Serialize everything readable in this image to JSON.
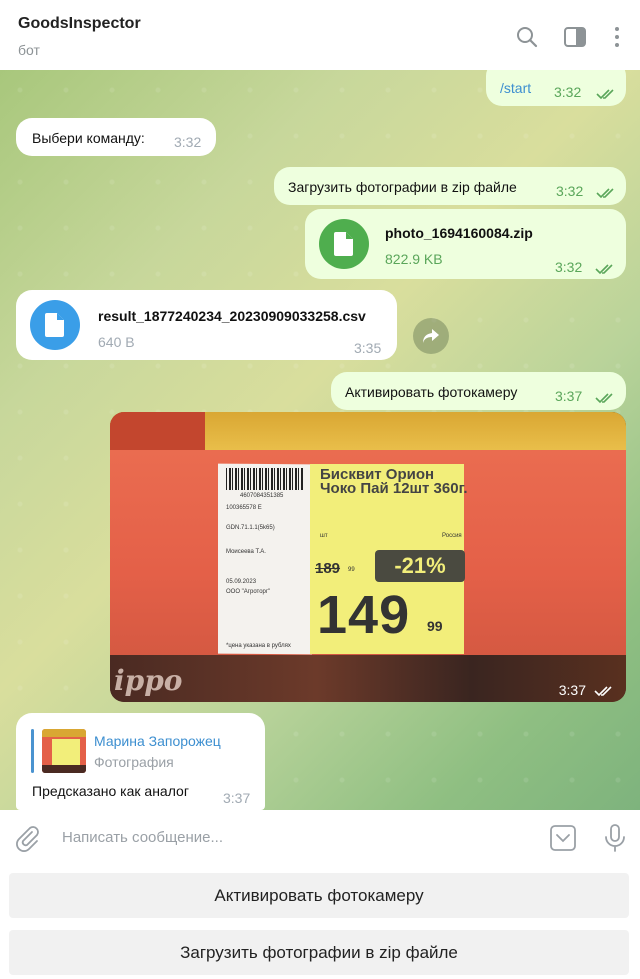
{
  "header": {
    "title": "GoodsInspector",
    "subtitle": "бот",
    "icons": [
      "search-icon",
      "sidebar-toggle-icon",
      "more-vertical-icon"
    ]
  },
  "messages": {
    "m1": {
      "text": "/start",
      "time": "3:32",
      "direction": "outgoing",
      "status": "read"
    },
    "m2": {
      "text": "Выбери команду:",
      "time": "3:32",
      "direction": "incoming"
    },
    "m3": {
      "text": "Загрузить фотографии в zip файле",
      "time": "3:32",
      "direction": "outgoing",
      "status": "read"
    },
    "m4": {
      "file_name": "photo_1694160084.zip",
      "file_size": "822.9 KB",
      "time": "3:32",
      "direction": "outgoing",
      "status": "read",
      "icon": "file-icon"
    },
    "m5": {
      "file_name": "result_1877240234_20230909033258.csv",
      "file_size": "640 B",
      "time": "3:35",
      "direction": "incoming",
      "icon": "file-icon",
      "action_icon": "share-icon"
    },
    "m6": {
      "text": "Активировать фотокамеру",
      "time": "3:37",
      "direction": "outgoing",
      "status": "read"
    },
    "m7": {
      "type": "photo",
      "time": "3:37",
      "direction": "outgoing",
      "status": "read",
      "tag": {
        "barcode_number": "4607084351385",
        "code": "100365578 E",
        "line1": "GDN.71.1.1(5k65)",
        "line2": "Моисеева Т.А.",
        "date": "05.09.2023",
        "company": "ООО \"Агроторг\"",
        "product": "Бисквит Орион Чоко Пай 12шт 360г.",
        "country": "Россия",
        "per": "шт",
        "old_price": "189",
        "old_price_suffix": "99",
        "discount": "-21%",
        "price": "149",
        "price_cents": "99",
        "footer": "*цена указана в рублях"
      },
      "bottom_text": "ippo"
    },
    "m8": {
      "reply_name": "Марина Запорожец",
      "reply_type": "Фотография",
      "text": "Предсказано как аналог",
      "time": "3:37",
      "direction": "incoming"
    }
  },
  "input": {
    "placeholder": "Написать сообщение...",
    "icons": [
      "attach-icon",
      "keyboard-toggle-icon",
      "microphone-icon"
    ]
  },
  "keyboard": {
    "buttons": [
      "Активировать фотокамеру",
      "Загрузить фотографии в zip файле"
    ]
  },
  "colors": {
    "outgoing_bubble": "#eeffde",
    "incoming_bubble": "#ffffff",
    "accent_blue": "#3d8fd0",
    "file_icon_green": "#4fae4e",
    "file_icon_blue": "#3a9ee8",
    "read_ticks": "#5aa65a"
  }
}
